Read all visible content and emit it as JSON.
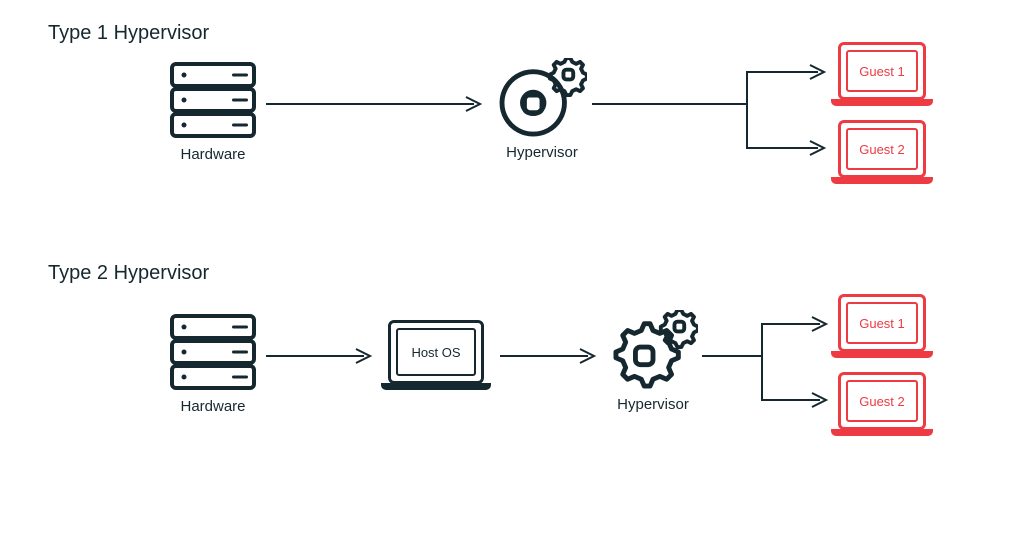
{
  "sections": {
    "type1": {
      "title": "Type 1 Hypervisor"
    },
    "type2": {
      "title": "Type 2 Hypervisor"
    }
  },
  "labels": {
    "hardware": "Hardware",
    "hypervisor": "Hypervisor",
    "hostOS": "Host OS",
    "guest1": "Guest 1",
    "guest2": "Guest 2"
  },
  "colors": {
    "primary": "#16282f",
    "accent": "#ee3a43"
  }
}
